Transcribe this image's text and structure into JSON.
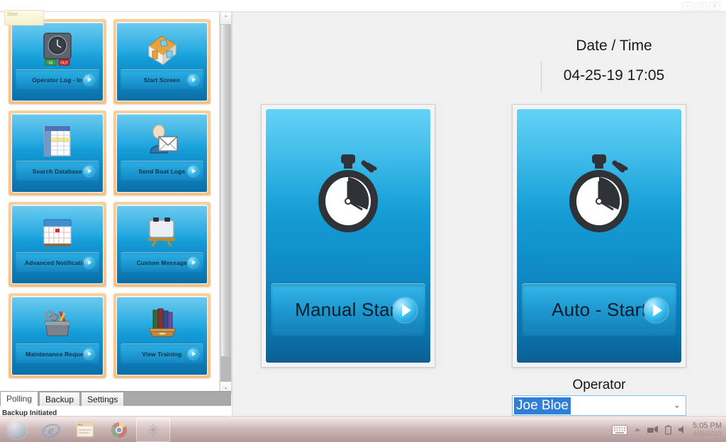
{
  "window": {
    "controls": [
      "–",
      "□",
      "✕"
    ],
    "corner_tab_text": "Start"
  },
  "left_panel": {
    "tiles": [
      {
        "label": "Operator Log - In",
        "icon": "time-clock-icon"
      },
      {
        "label": "Start Screen",
        "icon": "house-icon"
      },
      {
        "label": "Search Database",
        "icon": "spreadsheet-icon"
      },
      {
        "label": "Send Boat Logs",
        "icon": "person-envelope-icon"
      },
      {
        "label": "Advanced Notification",
        "icon": "calendar-icon"
      },
      {
        "label": "Custom Message",
        "icon": "whiteboard-easel-icon"
      },
      {
        "label": "Maintenance Request",
        "icon": "toolbox-icon"
      },
      {
        "label": "View Training",
        "icon": "books-icon"
      }
    ],
    "scrollbar": {
      "up": "⌃",
      "down": "⌄"
    }
  },
  "tabs": {
    "items": [
      {
        "label": "Polling",
        "active": true
      },
      {
        "label": "Backup",
        "active": false
      },
      {
        "label": "Settings",
        "active": false
      }
    ]
  },
  "status": {
    "text": "Backup Initiated"
  },
  "main": {
    "datetime": {
      "label": "Date / Time",
      "value": "04-25-19 17:05"
    },
    "actions": [
      {
        "label": "Manual Start",
        "icon": "stopwatch-icon"
      },
      {
        "label": "Auto - Start",
        "icon": "stopwatch-icon"
      }
    ],
    "operator": {
      "label": "Operator",
      "value": "Joe Bloe",
      "options": [
        "Joe Bloe"
      ],
      "caret": "⌄"
    }
  },
  "taskbar": {
    "apps": [
      {
        "name": "start-orb",
        "active": false
      },
      {
        "name": "internet-explorer",
        "active": false
      },
      {
        "name": "window-app",
        "active": false
      },
      {
        "name": "google-chrome",
        "active": false
      },
      {
        "name": "boat-logs-app",
        "active": true
      }
    ],
    "tray": [
      "keyboard-icon",
      "show-hidden-icon",
      "network-icon",
      "battery-icon",
      "volume-icon"
    ],
    "clock": {
      "time": "5:05 PM",
      "date": "4/25/2019"
    }
  },
  "colors": {
    "tile_border": "#f6c187",
    "tile_blue": "#17a3dd",
    "panel_bg": "#f0f0f0",
    "select_highlight": "#2f7fd8"
  }
}
